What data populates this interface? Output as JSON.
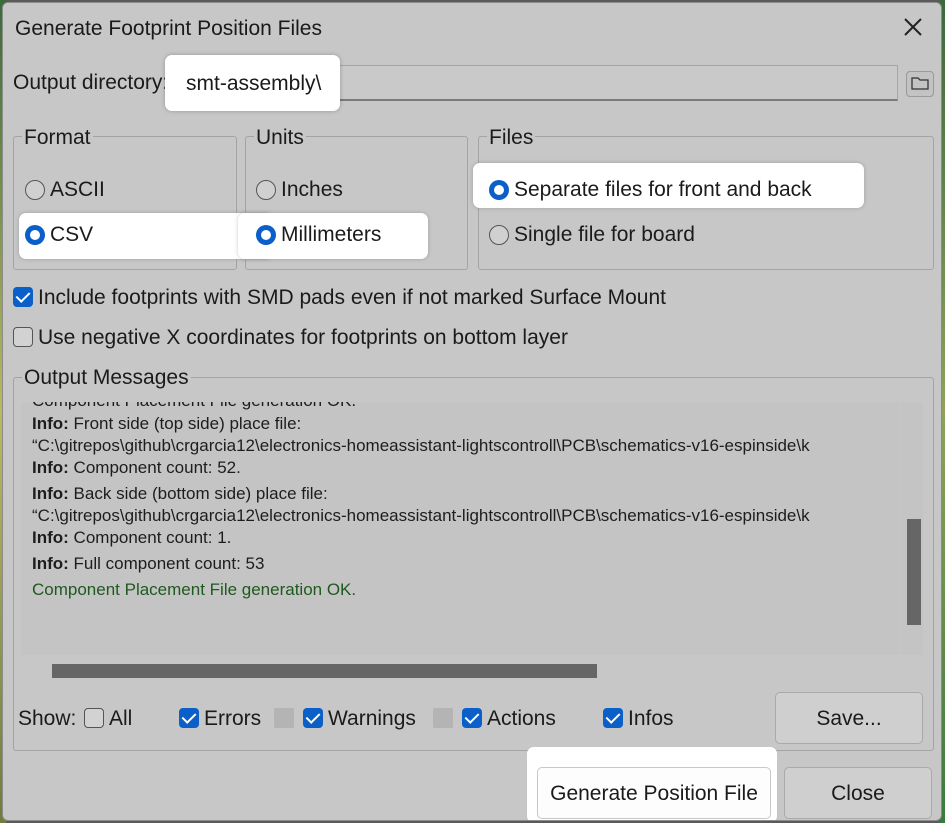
{
  "window": {
    "title": "Generate Footprint Position Files"
  },
  "output_directory": {
    "label": "Output directory:",
    "value": "smt-assembly\\"
  },
  "format": {
    "title": "Format",
    "options": [
      {
        "label": "ASCII",
        "selected": false
      },
      {
        "label": "CSV",
        "selected": true
      }
    ]
  },
  "units": {
    "title": "Units",
    "options": [
      {
        "label": "Inches",
        "selected": false
      },
      {
        "label": "Millimeters",
        "selected": true
      }
    ]
  },
  "files": {
    "title": "Files",
    "options": [
      {
        "label": "Separate files for front and back",
        "selected": true
      },
      {
        "label": "Single file for board",
        "selected": false
      }
    ]
  },
  "options": {
    "include_smd": {
      "label": "Include footprints with SMD pads even if not marked Surface Mount",
      "checked": true
    },
    "negative_x": {
      "label": "Use negative X coordinates for footprints on bottom layer",
      "checked": false
    }
  },
  "output_messages": {
    "title": "Output Messages",
    "partial_top": "Component Placement File generation OK.",
    "lines": [
      {
        "prefix": "Info:",
        "text": " Front side (top side) place file:"
      },
      {
        "prefix": "",
        "text": "“C:\\gitrepos\\github\\crgarcia12\\electronics-homeassistant-lightscontroll\\PCB\\schematics-v16-espinside\\k"
      },
      {
        "prefix": "Info:",
        "text": " Component count: 52."
      },
      {
        "prefix": "Info:",
        "text": " Back side (bottom side) place file:"
      },
      {
        "prefix": "",
        "text": "“C:\\gitrepos\\github\\crgarcia12\\electronics-homeassistant-lightscontroll\\PCB\\schematics-v16-espinside\\k"
      },
      {
        "prefix": "Info:",
        "text": " Component count: 1."
      },
      {
        "prefix": "Info:",
        "text": " Full component count: 53"
      }
    ],
    "success": "Component Placement File generation OK."
  },
  "filters": {
    "show_label": "Show:",
    "items": [
      {
        "label": "All",
        "checked": false
      },
      {
        "label": "Errors",
        "checked": true
      },
      {
        "label": "Warnings",
        "checked": true
      },
      {
        "label": "Actions",
        "checked": true
      },
      {
        "label": "Infos",
        "checked": true
      }
    ]
  },
  "buttons": {
    "save": "Save...",
    "generate": "Generate Position File",
    "close": "Close"
  },
  "colors": {
    "accent": "#0a5fc8",
    "dialog_bg": "#c7c7c7",
    "success_text": "#1e5a1e",
    "highlight": "#ffffff"
  },
  "icons": {
    "close": "close-icon",
    "folder": "folder-icon"
  }
}
